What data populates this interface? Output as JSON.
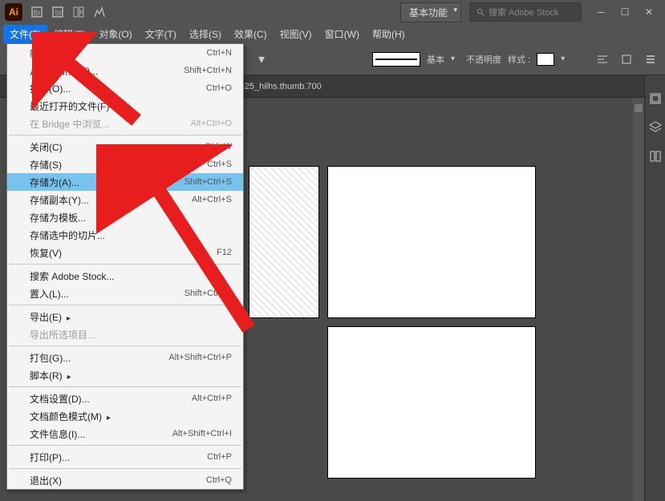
{
  "titlebar": {
    "workspace": "基本功能",
    "search_placeholder": "搜索 Adobe Stock"
  },
  "menubar": {
    "items": [
      "文件(F)",
      "编辑(E)",
      "对象(O)",
      "文字(T)",
      "选择(S)",
      "效果(C)",
      "视图(V)",
      "窗口(W)",
      "帮助(H)"
    ]
  },
  "toolbar": {
    "stroke_label": "基本",
    "opacity_label": "不透明度",
    "style_label": "样式 :"
  },
  "tab": {
    "path": "%2Fuploads%2Fitem%2F201808%2F02%2F20180802173625_hilhs.thumb.700"
  },
  "file_menu": {
    "items": [
      {
        "label": "新建(N)...",
        "shortcut": "Ctrl+N"
      },
      {
        "label": "从模板新建(T)...",
        "shortcut": "Shift+Ctrl+N"
      },
      {
        "label": "打开(O)...",
        "shortcut": "Ctrl+O"
      },
      {
        "label": "最近打开的文件(F)",
        "arrow": true
      },
      {
        "label": "在 Bridge 中浏览...",
        "shortcut": "Alt+Ctrl+O",
        "disabled": true
      },
      {
        "sep": true
      },
      {
        "label": "关闭(C)",
        "shortcut": "Ctrl+W"
      },
      {
        "label": "存储(S)",
        "shortcut": "Ctrl+S"
      },
      {
        "label": "存储为(A)...",
        "shortcut": "Shift+Ctrl+S",
        "highlight": true
      },
      {
        "label": "存储副本(Y)...",
        "shortcut": "Alt+Ctrl+S"
      },
      {
        "label": "存储为模板..."
      },
      {
        "label": "存储选中的切片..."
      },
      {
        "label": "恢复(V)",
        "shortcut": "F12"
      },
      {
        "sep": true
      },
      {
        "label": "搜索 Adobe Stock..."
      },
      {
        "label": "置入(L)...",
        "shortcut": "Shift+Ctrl+P"
      },
      {
        "sep": true
      },
      {
        "label": "导出(E)",
        "arrow": true
      },
      {
        "label": "导出所选项目...",
        "disabled": true
      },
      {
        "sep": true
      },
      {
        "label": "打包(G)...",
        "shortcut": "Alt+Shift+Ctrl+P"
      },
      {
        "label": "脚本(R)",
        "arrow": true
      },
      {
        "sep": true
      },
      {
        "label": "文档设置(D)...",
        "shortcut": "Alt+Ctrl+P"
      },
      {
        "label": "文档颜色模式(M)",
        "arrow": true
      },
      {
        "label": "文件信息(I)...",
        "shortcut": "Alt+Shift+Ctrl+I"
      },
      {
        "sep": true
      },
      {
        "label": "打印(P)...",
        "shortcut": "Ctrl+P"
      },
      {
        "sep": true
      },
      {
        "label": "退出(X)",
        "shortcut": "Ctrl+Q"
      }
    ]
  }
}
